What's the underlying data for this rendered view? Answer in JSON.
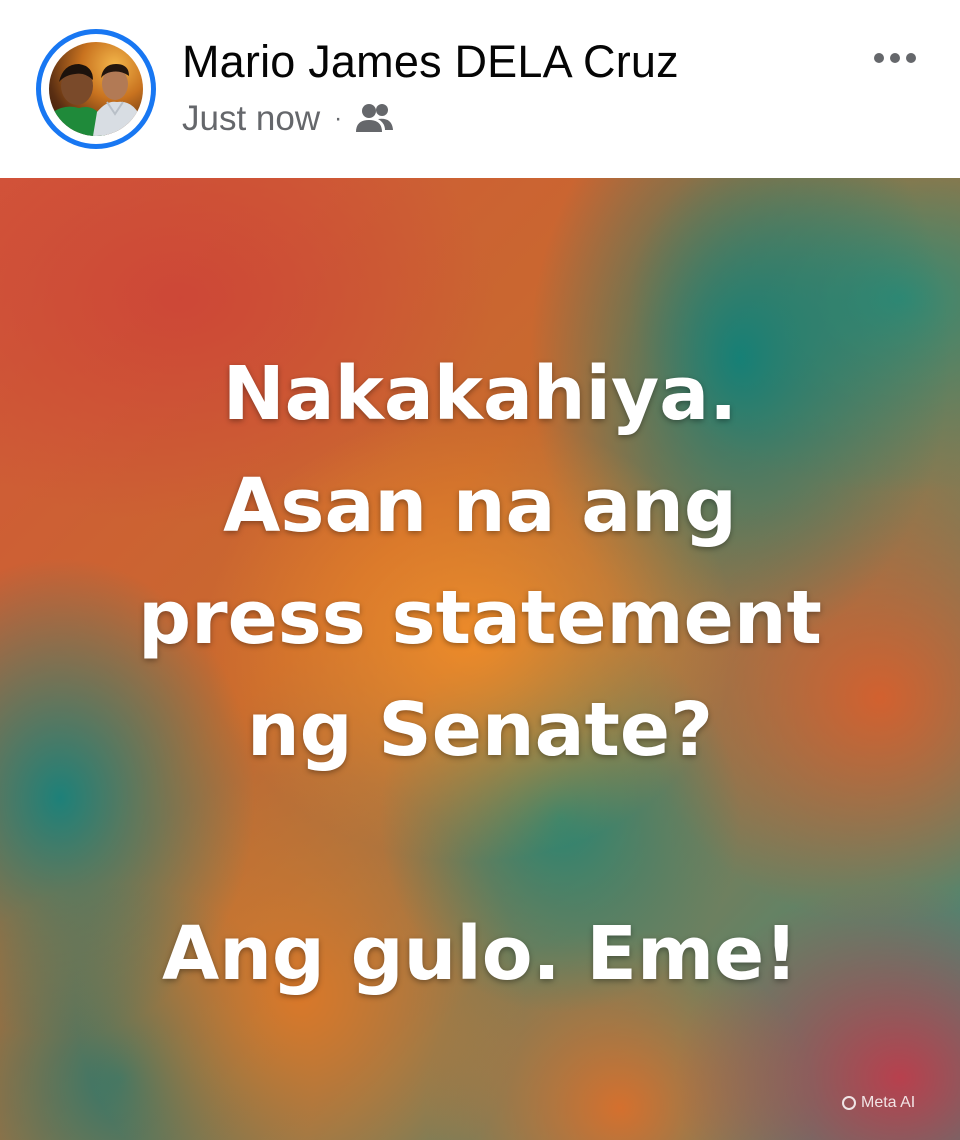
{
  "post": {
    "author": "Mario James DELA Cruz",
    "timestamp": "Just now",
    "separator": "·",
    "audience_icon": "friends-icon",
    "more_icon": "more-horizontal-icon",
    "text_lines": [
      "Nakakahiya.",
      "Asan na ang",
      "press statement",
      "ng Senate?",
      "",
      "Ang gulo. Eme!"
    ],
    "watermark": "Meta AI"
  },
  "colors": {
    "accent_ring": "#1877f2",
    "name_text": "#050505",
    "meta_text": "#65676b"
  }
}
